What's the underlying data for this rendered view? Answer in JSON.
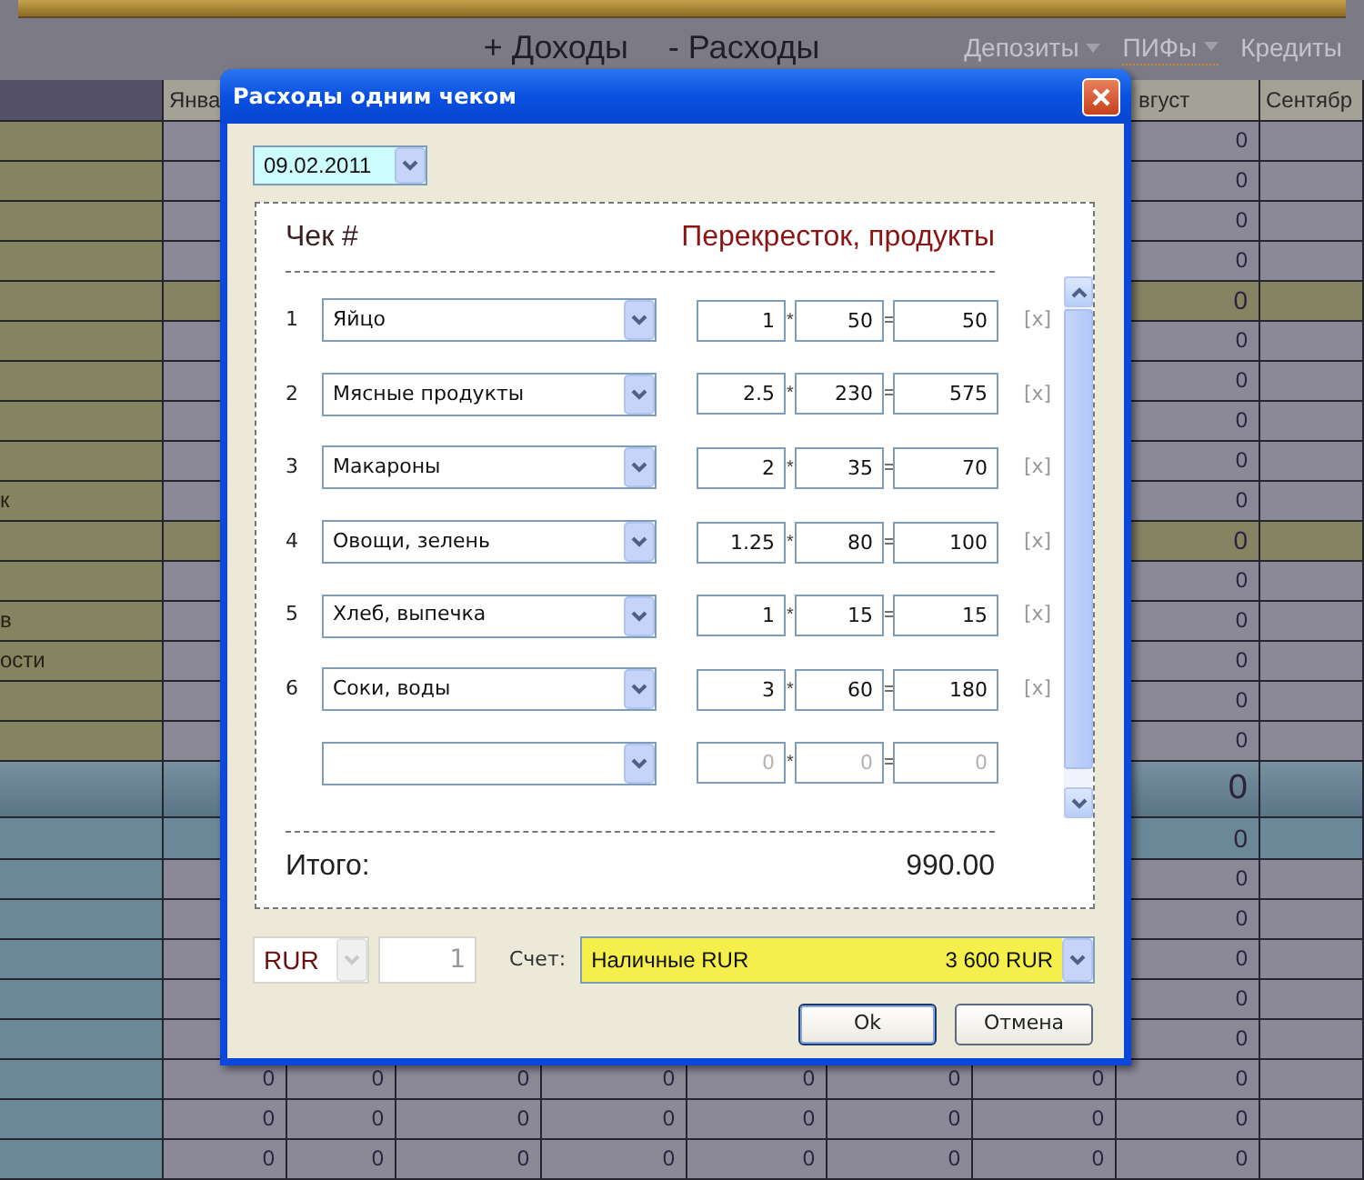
{
  "top_nav": {
    "links": [
      {
        "label": "+ Доходы"
      },
      {
        "label": "- Расходы"
      }
    ],
    "menus": [
      {
        "label": "Депозиты",
        "dropdown": true,
        "selected": false
      },
      {
        "label": "ПИФы",
        "dropdown": true,
        "selected": true
      },
      {
        "label": "Кредиты",
        "dropdown": false,
        "selected": false
      }
    ]
  },
  "sheet": {
    "columns": [
      "Янва",
      null,
      null,
      null,
      null,
      null,
      null,
      "вгуст",
      "Сентябр"
    ],
    "rows": [
      {
        "kind": "item",
        "cells": [
          null,
          null,
          null,
          null,
          null,
          null,
          null,
          "0",
          null
        ]
      },
      {
        "kind": "item",
        "cells": [
          null,
          null,
          null,
          null,
          null,
          null,
          null,
          "0",
          null
        ]
      },
      {
        "kind": "item",
        "cells": [
          null,
          null,
          null,
          null,
          null,
          null,
          null,
          "0",
          null
        ]
      },
      {
        "kind": "item",
        "cells": [
          null,
          null,
          null,
          null,
          null,
          null,
          null,
          "0",
          null
        ]
      },
      {
        "kind": "subtotal",
        "cells": [
          null,
          null,
          null,
          null,
          null,
          null,
          null,
          "0",
          null
        ]
      },
      {
        "kind": "item",
        "cells": [
          null,
          null,
          null,
          null,
          null,
          null,
          null,
          "0",
          null
        ]
      },
      {
        "kind": "item",
        "cells": [
          null,
          null,
          null,
          null,
          null,
          null,
          null,
          "0",
          null
        ]
      },
      {
        "kind": "item",
        "cells": [
          null,
          null,
          null,
          null,
          null,
          null,
          null,
          "0",
          null
        ]
      },
      {
        "kind": "item",
        "cells": [
          null,
          null,
          null,
          null,
          null,
          null,
          null,
          "0",
          null
        ]
      },
      {
        "kind": "item",
        "label": "к",
        "cells": [
          null,
          null,
          null,
          null,
          null,
          null,
          null,
          "0",
          null
        ]
      },
      {
        "kind": "subtotal",
        "cells": [
          null,
          null,
          null,
          null,
          null,
          null,
          null,
          "0",
          null
        ]
      },
      {
        "kind": "item",
        "cells": [
          null,
          null,
          null,
          null,
          null,
          null,
          null,
          "0",
          null
        ]
      },
      {
        "kind": "item",
        "label": "в",
        "cells": [
          null,
          null,
          null,
          null,
          null,
          null,
          null,
          "0",
          null
        ]
      },
      {
        "kind": "item",
        "label": "ости",
        "cells": [
          null,
          null,
          null,
          null,
          null,
          null,
          null,
          "0",
          null
        ]
      },
      {
        "kind": "item",
        "cells": [
          null,
          null,
          null,
          null,
          null,
          null,
          null,
          "0",
          null
        ]
      },
      {
        "kind": "item",
        "cells": [
          null,
          null,
          null,
          null,
          null,
          null,
          null,
          "0",
          null
        ]
      },
      {
        "kind": "total",
        "cells": [
          null,
          null,
          null,
          null,
          null,
          null,
          null,
          "0",
          null
        ]
      },
      {
        "kind": "group",
        "cells": [
          null,
          null,
          null,
          null,
          null,
          null,
          null,
          "0",
          null
        ]
      },
      {
        "kind": "account",
        "cells": [
          null,
          null,
          null,
          null,
          null,
          null,
          null,
          "0",
          null
        ]
      },
      {
        "kind": "account",
        "cells": [
          null,
          null,
          null,
          null,
          null,
          null,
          null,
          "0",
          null
        ]
      },
      {
        "kind": "account",
        "cells": [
          null,
          null,
          null,
          null,
          null,
          null,
          null,
          "0",
          null
        ]
      },
      {
        "kind": "account",
        "cells": [
          null,
          null,
          null,
          null,
          null,
          null,
          null,
          "0",
          null
        ]
      },
      {
        "kind": "account",
        "cells": [
          null,
          null,
          null,
          null,
          null,
          null,
          null,
          "0",
          null
        ]
      },
      {
        "kind": "account",
        "cells": [
          "0",
          "0",
          "0",
          "0",
          "0",
          "0",
          "0",
          "0",
          null
        ]
      },
      {
        "kind": "account",
        "cells": [
          "0",
          "0",
          "0",
          "0",
          "0",
          "0",
          "0",
          "0",
          null
        ]
      },
      {
        "kind": "account",
        "cells": [
          "0",
          "0",
          "0",
          "0",
          "0",
          "0",
          "0",
          "0",
          null
        ]
      }
    ]
  },
  "dialog": {
    "title": "Расходы одним чеком",
    "date": "09.02.2011",
    "receipt": {
      "label": "Чек #",
      "store": "Перекресток, продукты",
      "items": [
        {
          "number": "1",
          "category": "Яйцо",
          "quantity": "1",
          "multiply_sign": "*",
          "price": "50",
          "equals_sign": "=",
          "sum": "50",
          "remove": "[x]"
        },
        {
          "number": "2",
          "category": "Мясные продукты",
          "quantity": "2.5",
          "multiply_sign": "*",
          "price": "230",
          "equals_sign": "=",
          "sum": "575",
          "remove": "[x]"
        },
        {
          "number": "3",
          "category": "Макароны",
          "quantity": "2",
          "multiply_sign": "*",
          "price": "35",
          "equals_sign": "=",
          "sum": "70",
          "remove": "[x]"
        },
        {
          "number": "4",
          "category": "Овощи, зелень",
          "quantity": "1.25",
          "multiply_sign": "*",
          "price": "80",
          "equals_sign": "=",
          "sum": "100",
          "remove": "[x]"
        },
        {
          "number": "5",
          "category": "Хлеб, выпечка",
          "quantity": "1",
          "multiply_sign": "*",
          "price": "15",
          "equals_sign": "=",
          "sum": "15",
          "remove": "[x]"
        },
        {
          "number": "6",
          "category": "Соки, воды",
          "quantity": "3",
          "multiply_sign": "*",
          "price": "60",
          "equals_sign": "=",
          "sum": "180",
          "remove": "[x]"
        }
      ],
      "blank_row": {
        "quantity_placeholder": "0",
        "multiply_sign": "*",
        "price_placeholder": "0",
        "equals_sign": "=",
        "sum_placeholder": "0"
      },
      "total_label": "Итого:",
      "total": "990.00"
    },
    "currency": {
      "value": "RUR",
      "disabled": true
    },
    "rate": {
      "value": "1",
      "disabled": true
    },
    "account_label": "Счет:",
    "account": {
      "name": "Наличные RUR",
      "balance": "3 600 RUR"
    },
    "buttons": [
      {
        "label": "Ok",
        "kind": "default"
      },
      {
        "label": "Отмена",
        "kind": "normal"
      }
    ]
  }
}
